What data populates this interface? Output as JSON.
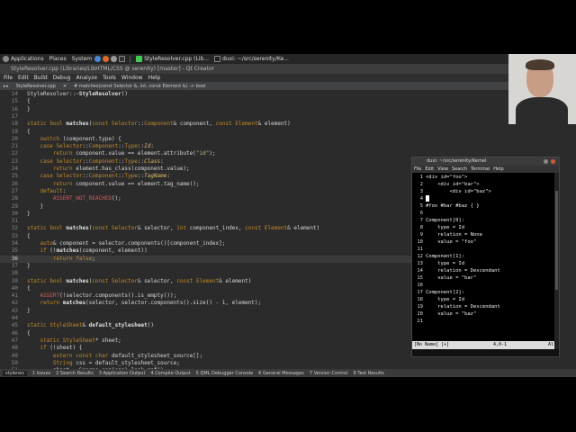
{
  "gnome": {
    "applications": "Applications",
    "places": "Places",
    "system": "System",
    "task1": "StyleResolver.cpp (Lib...",
    "task2": "duxi: ~/src/serenity/Ke..."
  },
  "qt": {
    "window_title": "StyleResolver.cpp (Libraries/LibHTML/CSS @ serenity) [master] - Qt Creator",
    "menu": [
      "File",
      "Edit",
      "Build",
      "Debug",
      "Analyze",
      "Tools",
      "Window",
      "Help"
    ],
    "header": {
      "file": "StyleResolver.cpp",
      "symbol": "# matches(const Selector &, int, const Element &) -> bool"
    }
  },
  "code": [
    {
      "n": "14",
      "t": "StyleResolver::~StyleResolver()"
    },
    {
      "n": "15",
      "t": "{"
    },
    {
      "n": "16",
      "t": "}"
    },
    {
      "n": "17",
      "t": ""
    },
    {
      "n": "18",
      "t": "static bool matches(const Selector::Component& component, const Element& element)"
    },
    {
      "n": "19",
      "t": "{"
    },
    {
      "n": "20",
      "t": "    switch (component.type) {"
    },
    {
      "n": "21",
      "t": "    case Selector::Component::Type::Id:"
    },
    {
      "n": "22",
      "t": "        return component.value == element.attribute(\"id\");"
    },
    {
      "n": "23",
      "t": "    case Selector::Component::Type::Class:"
    },
    {
      "n": "24",
      "t": "        return element.has_class(component.value);"
    },
    {
      "n": "25",
      "t": "    case Selector::Component::Type::TagName:"
    },
    {
      "n": "26",
      "t": "        return component.value == element.tag_name();"
    },
    {
      "n": "27",
      "t": "    default:"
    },
    {
      "n": "28",
      "t": "        ASSERT_NOT_REACHED();"
    },
    {
      "n": "29",
      "t": "    }"
    },
    {
      "n": "30",
      "t": "}"
    },
    {
      "n": "31",
      "t": ""
    },
    {
      "n": "32",
      "t": "static bool matches(const Selector& selector, int component_index, const Element& element)"
    },
    {
      "n": "33",
      "t": "{"
    },
    {
      "n": "34",
      "t": "    auto& component = selector.components()[component_index];"
    },
    {
      "n": "35",
      "t": "    if (!matches(component, element))"
    },
    {
      "n": "36",
      "t": "        return false;"
    },
    {
      "n": "37",
      "t": "}"
    },
    {
      "n": "38",
      "t": ""
    },
    {
      "n": "39",
      "t": "static bool matches(const Selector& selector, const Element& element)"
    },
    {
      "n": "40",
      "t": "{"
    },
    {
      "n": "41",
      "t": "    ASSERT(!selector.components().is_empty());"
    },
    {
      "n": "42",
      "t": "    return matches(selector, selector.components().size() - 1, element);"
    },
    {
      "n": "43",
      "t": "}"
    },
    {
      "n": "44",
      "t": ""
    },
    {
      "n": "45",
      "t": "static StyleSheet& default_stylesheet()"
    },
    {
      "n": "46",
      "t": "{"
    },
    {
      "n": "47",
      "t": "    static StyleSheet* sheet;"
    },
    {
      "n": "48",
      "t": "    if (!sheet) {"
    },
    {
      "n": "49",
      "t": "        extern const char default_stylesheet_source[];"
    },
    {
      "n": "50",
      "t": "        String css = default_stylesheet_source;"
    },
    {
      "n": "51",
      "t": "        sheet = &parse_css(css).leak_ref();"
    }
  ],
  "current_line": "36",
  "output_tabs": [
    "1 Issues",
    "2 Search Results",
    "3 Application Output",
    "4 Compile Output",
    "5 QML Debugger Console",
    "6 General Messages",
    "7 Version Control",
    "8 Test Results"
  ],
  "output_search": "stylenes",
  "terminal": {
    "title": "duxi: ~/src/serenity/Kernel",
    "menu": [
      "File",
      "Edit",
      "View",
      "Search",
      "Terminal",
      "Help"
    ],
    "lines": [
      {
        "n": "1",
        "t": "<div id=\"foo\">"
      },
      {
        "n": "2",
        "t": "    <div id=\"bar\">"
      },
      {
        "n": "3",
        "t": "        <div id=\"baz\">"
      },
      {
        "n": "4",
        "t": ""
      },
      {
        "n": "5",
        "t": "#foo #bar #baz { }"
      },
      {
        "n": "6",
        "t": ""
      },
      {
        "n": "7",
        "t": "Component[0]:"
      },
      {
        "n": "8",
        "t": "    type = Id"
      },
      {
        "n": "9",
        "t": "    relation = None"
      },
      {
        "n": "10",
        "t": "    value = \"foo\""
      },
      {
        "n": "11",
        "t": ""
      },
      {
        "n": "12",
        "t": "Component[1]:"
      },
      {
        "n": "13",
        "t": "    type = Id"
      },
      {
        "n": "14",
        "t": "    relation = Descendant"
      },
      {
        "n": "15",
        "t": "    value = \"bar\""
      },
      {
        "n": "16",
        "t": ""
      },
      {
        "n": "17",
        "t": "Component[2]:"
      },
      {
        "n": "18",
        "t": "    type = Id"
      },
      {
        "n": "19",
        "t": "    relation = Descendant"
      },
      {
        "n": "20",
        "t": "    value = \"baz\""
      },
      {
        "n": "21",
        "t": ""
      }
    ],
    "status_left": "[No Name] [+]",
    "status_pos": "4,0-1",
    "status_right": "All"
  }
}
